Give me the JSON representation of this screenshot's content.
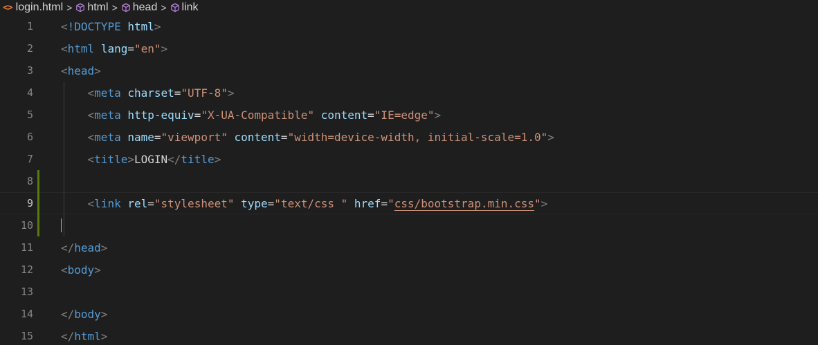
{
  "breadcrumb": {
    "file_icon": "<>",
    "file": "login.html",
    "separator": ">",
    "items": [
      "html",
      "head",
      "link"
    ]
  },
  "colors": {
    "background": "#1e1e1e",
    "tag": "#569cd6",
    "attribute": "#9cdcfe",
    "string": "#ce9178",
    "punctuation": "#808080",
    "text": "#d4d4d4",
    "line_number": "#858585",
    "modified_gutter": "#587c0c",
    "file_icon": "#e37933"
  },
  "editor": {
    "active_line": 9,
    "line_numbers": [
      "1",
      "2",
      "3",
      "4",
      "5",
      "6",
      "7",
      "8",
      "9",
      "10",
      "11",
      "12",
      "13",
      "14",
      "15"
    ],
    "lines": [
      {
        "number": "1",
        "segments": [
          [
            "punc",
            "<"
          ],
          [
            "tag",
            "!DOCTYPE "
          ],
          [
            "attr",
            "html"
          ],
          [
            "punc",
            ">"
          ]
        ]
      },
      {
        "number": "2",
        "segments": [
          [
            "punc",
            "<"
          ],
          [
            "tag",
            "html"
          ],
          [
            "txt",
            " "
          ],
          [
            "attr",
            "lang"
          ],
          [
            "txt",
            "="
          ],
          [
            "str",
            "\"en\""
          ],
          [
            "punc",
            ">"
          ]
        ]
      },
      {
        "number": "3",
        "segments": [
          [
            "punc",
            "<"
          ],
          [
            "tag",
            "head"
          ],
          [
            "punc",
            ">"
          ]
        ]
      },
      {
        "number": "4",
        "segments": [
          [
            "txt",
            "    "
          ],
          [
            "punc",
            "<"
          ],
          [
            "tag",
            "meta"
          ],
          [
            "txt",
            " "
          ],
          [
            "attr",
            "charset"
          ],
          [
            "txt",
            "="
          ],
          [
            "str",
            "\"UTF-8\""
          ],
          [
            "punc",
            ">"
          ]
        ]
      },
      {
        "number": "5",
        "segments": [
          [
            "txt",
            "    "
          ],
          [
            "punc",
            "<"
          ],
          [
            "tag",
            "meta"
          ],
          [
            "txt",
            " "
          ],
          [
            "attr",
            "http-equiv"
          ],
          [
            "txt",
            "="
          ],
          [
            "str",
            "\"X-UA-Compatible\""
          ],
          [
            "txt",
            " "
          ],
          [
            "attr",
            "content"
          ],
          [
            "txt",
            "="
          ],
          [
            "str",
            "\"IE=edge\""
          ],
          [
            "punc",
            ">"
          ]
        ]
      },
      {
        "number": "6",
        "segments": [
          [
            "txt",
            "    "
          ],
          [
            "punc",
            "<"
          ],
          [
            "tag",
            "meta"
          ],
          [
            "txt",
            " "
          ],
          [
            "attr",
            "name"
          ],
          [
            "txt",
            "="
          ],
          [
            "str",
            "\"viewport\""
          ],
          [
            "txt",
            " "
          ],
          [
            "attr",
            "content"
          ],
          [
            "txt",
            "="
          ],
          [
            "str",
            "\"width=device-width, initial-scale=1.0\""
          ],
          [
            "punc",
            ">"
          ]
        ]
      },
      {
        "number": "7",
        "segments": [
          [
            "txt",
            "    "
          ],
          [
            "punc",
            "<"
          ],
          [
            "tag",
            "title"
          ],
          [
            "punc",
            ">"
          ],
          [
            "txt",
            "LOGIN"
          ],
          [
            "punc",
            "</"
          ],
          [
            "tag",
            "title"
          ],
          [
            "punc",
            ">"
          ]
        ]
      },
      {
        "number": "8",
        "segments": []
      },
      {
        "number": "9",
        "segments": [
          [
            "txt",
            "    "
          ],
          [
            "punc",
            "<"
          ],
          [
            "tag",
            "link"
          ],
          [
            "txt",
            " "
          ],
          [
            "attr",
            "rel"
          ],
          [
            "txt",
            "="
          ],
          [
            "str",
            "\"stylesheet\""
          ],
          [
            "txt",
            " "
          ],
          [
            "attr",
            "type"
          ],
          [
            "txt",
            "="
          ],
          [
            "str",
            "\"text/css \""
          ],
          [
            "txt",
            " "
          ],
          [
            "attr",
            "href"
          ],
          [
            "txt",
            "="
          ],
          [
            "str",
            "\""
          ],
          [
            "link",
            "css/bootstrap.min.css"
          ],
          [
            "str",
            "\""
          ],
          [
            "punc",
            ">"
          ]
        ]
      },
      {
        "number": "10",
        "segments": []
      },
      {
        "number": "11",
        "segments": [
          [
            "punc",
            "</"
          ],
          [
            "tag",
            "head"
          ],
          [
            "punc",
            ">"
          ]
        ]
      },
      {
        "number": "12",
        "segments": [
          [
            "punc",
            "<"
          ],
          [
            "tag",
            "body"
          ],
          [
            "punc",
            ">"
          ]
        ]
      },
      {
        "number": "13",
        "segments": []
      },
      {
        "number": "14",
        "segments": [
          [
            "punc",
            "</"
          ],
          [
            "tag",
            "body"
          ],
          [
            "punc",
            ">"
          ]
        ]
      },
      {
        "number": "15",
        "segments": [
          [
            "punc",
            "</"
          ],
          [
            "tag",
            "html"
          ],
          [
            "punc",
            ">"
          ]
        ]
      }
    ]
  }
}
